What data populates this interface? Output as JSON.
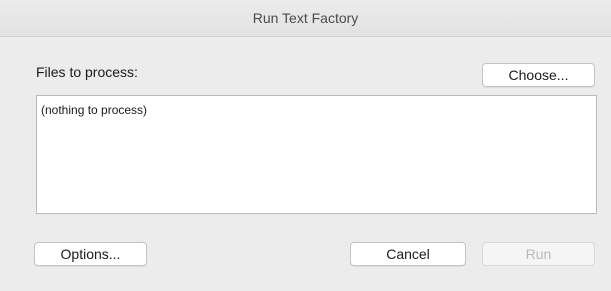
{
  "window": {
    "title": "Run Text Factory"
  },
  "files": {
    "label": "Files to process:",
    "choose_label": "Choose...",
    "empty_text": "(nothing to process)"
  },
  "footer": {
    "options_label": "Options...",
    "cancel_label": "Cancel",
    "run_label": "Run",
    "run_enabled": false
  }
}
